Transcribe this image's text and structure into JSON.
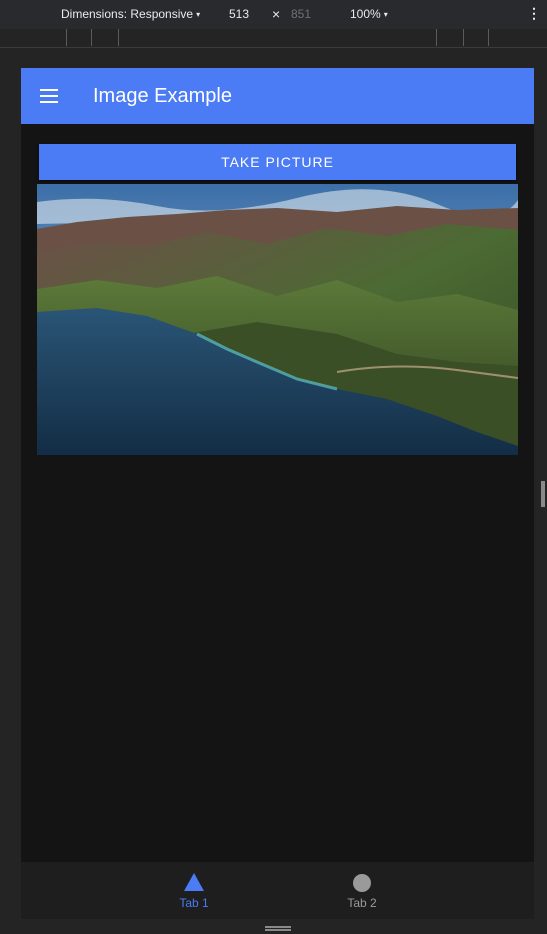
{
  "devtools": {
    "dimensions_label": "Dimensions: Responsive",
    "width_value": "513",
    "times_symbol": "×",
    "height_value": "851",
    "zoom_label": "100%",
    "caret": "▾",
    "more": "⋮"
  },
  "app": {
    "title": "Image Example",
    "take_picture_label": "TAKE PICTURE",
    "accent_color": "#4b7bf5",
    "photo_description_icon": "landscape-photo"
  },
  "tabs": [
    {
      "label": "Tab 1",
      "icon": "triangle-icon",
      "selected": true
    },
    {
      "label": "Tab 2",
      "icon": "circle-icon",
      "selected": false
    }
  ]
}
